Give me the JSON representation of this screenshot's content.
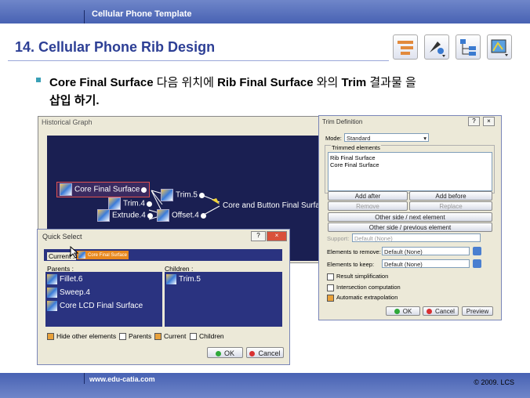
{
  "header": {
    "template_label": "Cellular Phone Template"
  },
  "title": "14. Cellular Phone Rib Design",
  "body": {
    "line1_a": "Core Final Surface",
    "line1_b": " 다음 위치에 ",
    "line1_c": "Rib Final Surface",
    "line1_d": " 와의 ",
    "line1_e": "Trim",
    "line1_f": " 결과물 을",
    "line2": "삽입 하기."
  },
  "historical_graph": {
    "title": "Historical Graph",
    "nodes": {
      "core": "Core Final Surface",
      "trim4": "Trim.4",
      "extrude4": "Extrude.4",
      "trim5": "Trim.5",
      "offset4": "Offset.4",
      "result": "Core and Button Final Surfa"
    }
  },
  "trim_definition": {
    "title": "Trim Definition",
    "mode_label": "Mode:",
    "mode_value": "Standard",
    "trimmed_label": "Trimmed elements",
    "trimmed_items": [
      "Rib Final Surface",
      "Core Final Surface"
    ],
    "add_after": "Add after",
    "add_before": "Add before",
    "remove": "Remove",
    "replace": "Replace",
    "other_side_next": "Other side / next element",
    "other_side_prev": "Other side / previous element",
    "support_label": "Support:",
    "support_value": "Default (None)",
    "remove_label": "Elements to remove:",
    "remove_value": "Default (None)",
    "keep_label": "Elements to keep:",
    "keep_value": "Default (None)",
    "result_simplification": "Result simplification",
    "intersection": "Intersection computation",
    "auto_extrap": "Automatic extrapolation",
    "ok": "OK",
    "cancel": "Cancel",
    "preview": "Preview",
    "help": "?",
    "close": "×"
  },
  "quick_select": {
    "title": "Quick Select",
    "current_label": "Current :",
    "current_value": "Core Final Surface",
    "parents_label": "Parents :",
    "children_label": "Children :",
    "parents": [
      "Fillet.6",
      "Sweep.4",
      "Core LCD Final Surface"
    ],
    "children": [
      "Trim.5"
    ],
    "hide_other": "Hide other elements",
    "opt_parents": "Parents",
    "opt_current": "Current",
    "opt_children": "Children",
    "ok": "OK",
    "cancel": "Cancel",
    "help": "?",
    "close": "×"
  },
  "footer": {
    "url": "www.edu-catia.com",
    "copyright": "© 2009. LCS"
  },
  "colors": {
    "header": "#5a72c0",
    "title": "#2d3f95",
    "graph_bg": "#1a1f52",
    "list_bg": "#2a3380",
    "dialog": "#ece9d8"
  }
}
